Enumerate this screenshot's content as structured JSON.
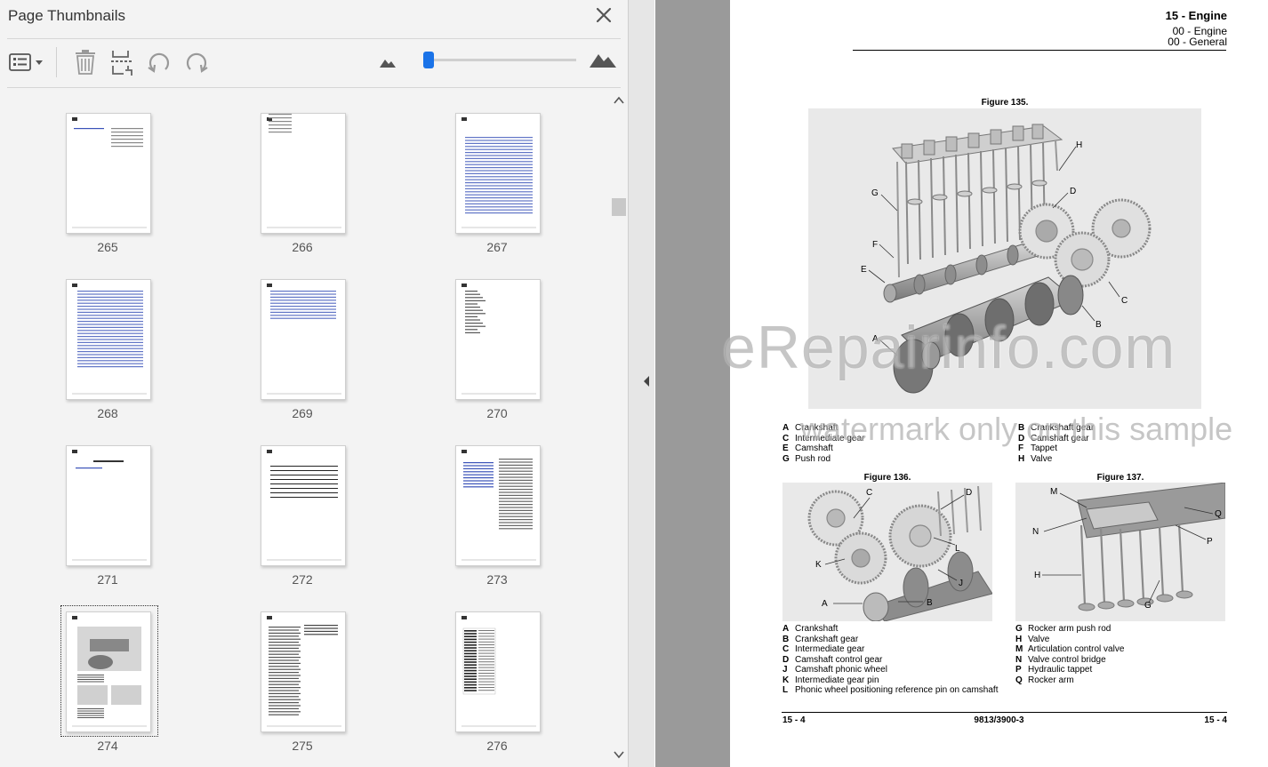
{
  "panel": {
    "title": "Page Thumbnails",
    "toolbar": {
      "options_icon": "list-options-icon",
      "delete_icon": "trash-icon",
      "insert_icon": "insert-page-icon",
      "undo_icon": "rotate-counterclockwise-icon",
      "redo_icon": "rotate-clockwise-icon",
      "zoom_out_icon": "small-mountain-icon",
      "zoom_in_icon": "large-mountain-icon",
      "zoom_fraction": 0.02
    },
    "pages": [
      "265",
      "266",
      "267",
      "268",
      "269",
      "270",
      "271",
      "272",
      "273",
      "274",
      "275",
      "276"
    ],
    "selected_page": "274"
  },
  "document": {
    "header": {
      "chapter": "15 - Engine",
      "section": "00 - Engine",
      "subsection": "00 - General"
    },
    "figure135": {
      "caption": "Figure 135.",
      "callouts": [
        "A",
        "B",
        "C",
        "D",
        "E",
        "F",
        "G",
        "H"
      ],
      "legend": [
        {
          "key": "A",
          "text": "Crankshaft"
        },
        {
          "key": "C",
          "text": "Intermediate gear"
        },
        {
          "key": "E",
          "text": "Camshaft"
        },
        {
          "key": "G",
          "text": "Push rod"
        }
      ],
      "legend_right": [
        {
          "key": "B",
          "text": "Crankshaft gear"
        },
        {
          "key": "D",
          "text": "Camshaft gear"
        },
        {
          "key": "F",
          "text": "Tappet"
        },
        {
          "key": "H",
          "text": "Valve"
        }
      ]
    },
    "figure136": {
      "caption": "Figure 136.",
      "callouts": [
        "A",
        "B",
        "C",
        "D",
        "J",
        "K",
        "L"
      ],
      "legend": [
        {
          "key": "A",
          "text": "Crankshaft"
        },
        {
          "key": "B",
          "text": "Crankshaft gear"
        },
        {
          "key": "C",
          "text": "Intermediate gear"
        },
        {
          "key": "D",
          "text": "Camshaft control gear"
        },
        {
          "key": "J",
          "text": "Camshaft phonic wheel"
        },
        {
          "key": "K",
          "text": "Intermediate gear pin"
        },
        {
          "key": "L",
          "text": "Phonic wheel positioning reference pin on camshaft"
        }
      ]
    },
    "figure137": {
      "caption": "Figure 137.",
      "callouts": [
        "G",
        "H",
        "M",
        "N",
        "P",
        "Q"
      ],
      "legend": [
        {
          "key": "G",
          "text": "Rocker arm push rod"
        },
        {
          "key": "H",
          "text": "Valve"
        },
        {
          "key": "M",
          "text": "Articulation control valve"
        },
        {
          "key": "N",
          "text": "Valve control bridge"
        },
        {
          "key": "P",
          "text": "Hydraulic tappet"
        },
        {
          "key": "Q",
          "text": "Rocker arm"
        }
      ]
    },
    "footer": {
      "left": "15 - 4",
      "center": "9813/3900-3",
      "right": "15 - 4"
    }
  },
  "watermark": {
    "line1": "eRepairinfo.com",
    "line2": "watermark only on this sample"
  },
  "colors": {
    "accent": "#1a73e8",
    "panel_bg": "#f3f3f3",
    "gutter": "#9a9a9a"
  }
}
